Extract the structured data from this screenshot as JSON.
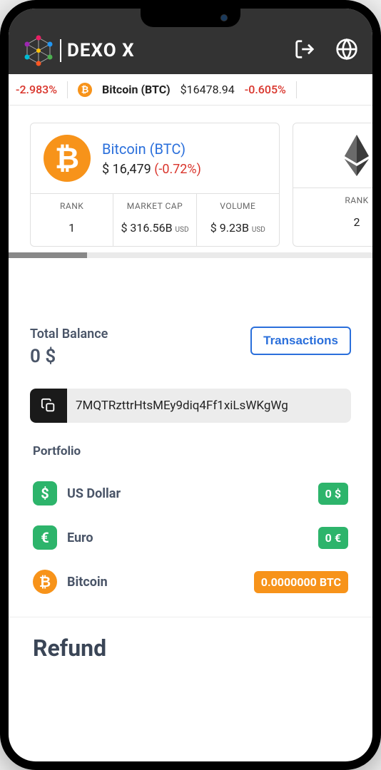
{
  "header": {
    "brand": "DEXO X"
  },
  "ticker": {
    "left_pct": "-2.983%",
    "coin_name": "Bitcoin (BTC)",
    "price": "$16478.94",
    "coin_pct": "-0.605%"
  },
  "cards": {
    "btc": {
      "name": "Bitcoin (BTC)",
      "price": "$ 16,479",
      "change": "(-0.72%)",
      "stats": {
        "rank_label": "RANK",
        "rank_value": "1",
        "mcap_label": "MARKET CAP",
        "mcap_value": "$ 316.56B",
        "mcap_unit": "USD",
        "vol_label": "VOLUME",
        "vol_value": "$ 9.23B",
        "vol_unit": "USD"
      }
    },
    "eth": {
      "rank_label": "RANK",
      "rank_value": "2"
    }
  },
  "balance": {
    "label": "Total Balance",
    "amount": "0 $",
    "transactions_button": "Transactions"
  },
  "address": "7MQTRzttrHtsMEy9diq4Ff1xiLsWKgWg",
  "portfolio": {
    "label": "Portfolio",
    "items": [
      {
        "name": "US Dollar",
        "amount": "0 $",
        "icon": "usd",
        "badge": "green"
      },
      {
        "name": "Euro",
        "amount": "0 €",
        "icon": "eur",
        "badge": "green"
      },
      {
        "name": "Bitcoin",
        "amount": "0.0000000 BTC",
        "icon": "btc",
        "badge": "orange"
      }
    ]
  },
  "refund": {
    "title": "Refund"
  }
}
